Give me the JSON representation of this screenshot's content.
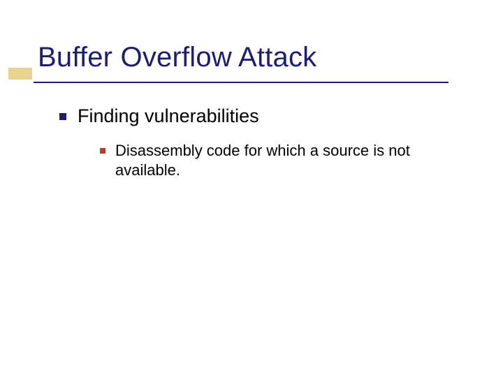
{
  "slide": {
    "title": "Buffer Overflow Attack",
    "bullets": [
      {
        "text": "Finding vulnerabilities",
        "children": [
          {
            "text": "Disassembly code for which a source is not available."
          }
        ]
      }
    ]
  },
  "colors": {
    "title": "#1e1e6e",
    "underline": "#1e1e6e",
    "accent_bar": "#e8d392",
    "bullet_level1": "#1e1e6e",
    "bullet_level2": "#b73a2a"
  }
}
